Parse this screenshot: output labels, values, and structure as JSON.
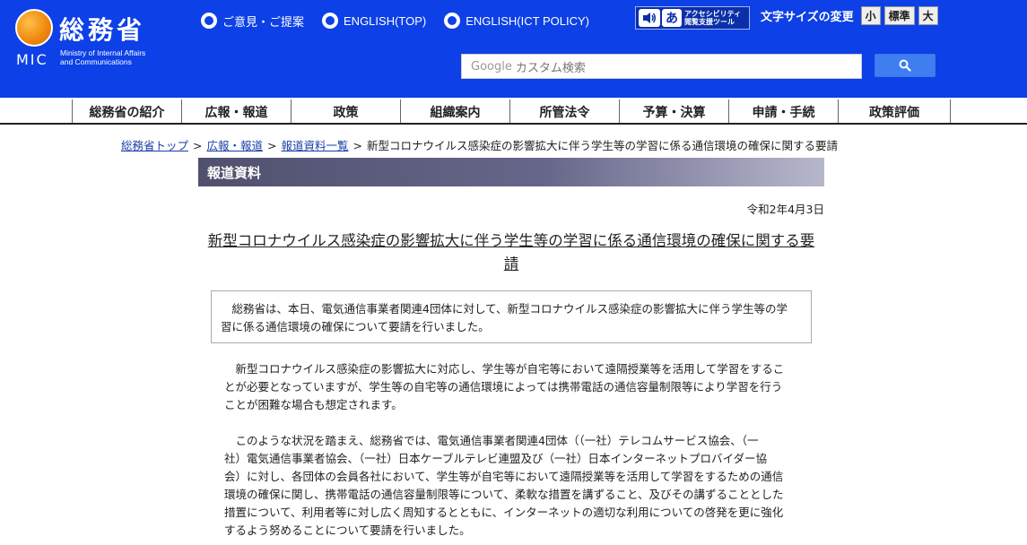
{
  "header": {
    "logo": {
      "kanji": "総務省",
      "abbr": "MIC",
      "en_line1": "Ministry of Internal Affairs",
      "en_line2": "and Communications"
    },
    "top_links": [
      {
        "label": "ご意見・ご提案"
      },
      {
        "label": "ENGLISH(TOP)"
      },
      {
        "label": "ENGLISH(ICT POLICY)"
      }
    ],
    "accessibility": {
      "line1": "アクセシビリティ",
      "line2": "閲覧支援ツール",
      "glyph": "あ"
    },
    "font_size": {
      "label": "文字サイズの変更",
      "small": "小",
      "standard": "標準",
      "large": "大"
    },
    "search": {
      "brand": "Google",
      "placeholder": "カスタム検索"
    }
  },
  "nav": {
    "items": [
      "総務省の紹介",
      "広報・報道",
      "政策",
      "組織案内",
      "所管法令",
      "予算・決算",
      "申請・手続",
      "政策評価"
    ]
  },
  "breadcrumb": {
    "items": [
      "総務省トップ",
      "広報・報道",
      "報道資料一覧"
    ],
    "current": "新型コロナウイルス感染症の影響拡大に伴う学生等の学習に係る通信環境の確保に関する要請",
    "separator": ">"
  },
  "section": {
    "title": "報道資料"
  },
  "article": {
    "date": "令和2年4月3日",
    "title_line1": "新型コロナウイルス感染症の影響拡大に伴う学生等の学習に係る通信環境の確保に関する要",
    "title_line2": "請",
    "summary_line1": "総務省は、本日、電気通信事業者関連4団体に対して、新型コロナウイルス感染症の影響拡大に伴う学生等の学",
    "summary_line2": "習に係る通信環境の確保について要請を行いました。",
    "p1_lines": [
      "新型コロナウイルス感染症の影響拡大に対応し、学生等が自宅等において遠隔授業等を活用して学習をするこ",
      "とが必要となっていますが、学生等の自宅等の通信環境によっては携帯電話の通信容量制限等により学習を行う",
      "ことが困難な場合も想定されます。"
    ],
    "p2_lines": [
      "このような状況を踏まえ、総務省では、電気通信事業者関連4団体（（一社）テレコムサービス協会、（一",
      "社）電気通信事業者協会、（一社）日本ケーブルテレビ連盟及び（一社）日本インターネットプロバイダー協",
      "会）に対し、各団体の会員各社において、学生等が自宅等において遠隔授業等を活用して学習をするための通信",
      "環境の確保に関し、携帯電話の通信容量制限等について、柔軟な措置を講ずること、及びその講ずることとした",
      "措置について、利用者等に対し広く周知するとともに、インターネットの適切な利用についての啓発を更に強化",
      "するよう努めることについて要請を行いました。"
    ]
  },
  "colors": {
    "header_blue": "#0d40e6",
    "link_blue": "#1a3ea8",
    "search_button": "#3f7ef0"
  },
  "icons": {
    "radio": "radio-icon",
    "speaker": "speaker-icon",
    "search": "search-icon",
    "logo": "mic-logo-icon"
  }
}
